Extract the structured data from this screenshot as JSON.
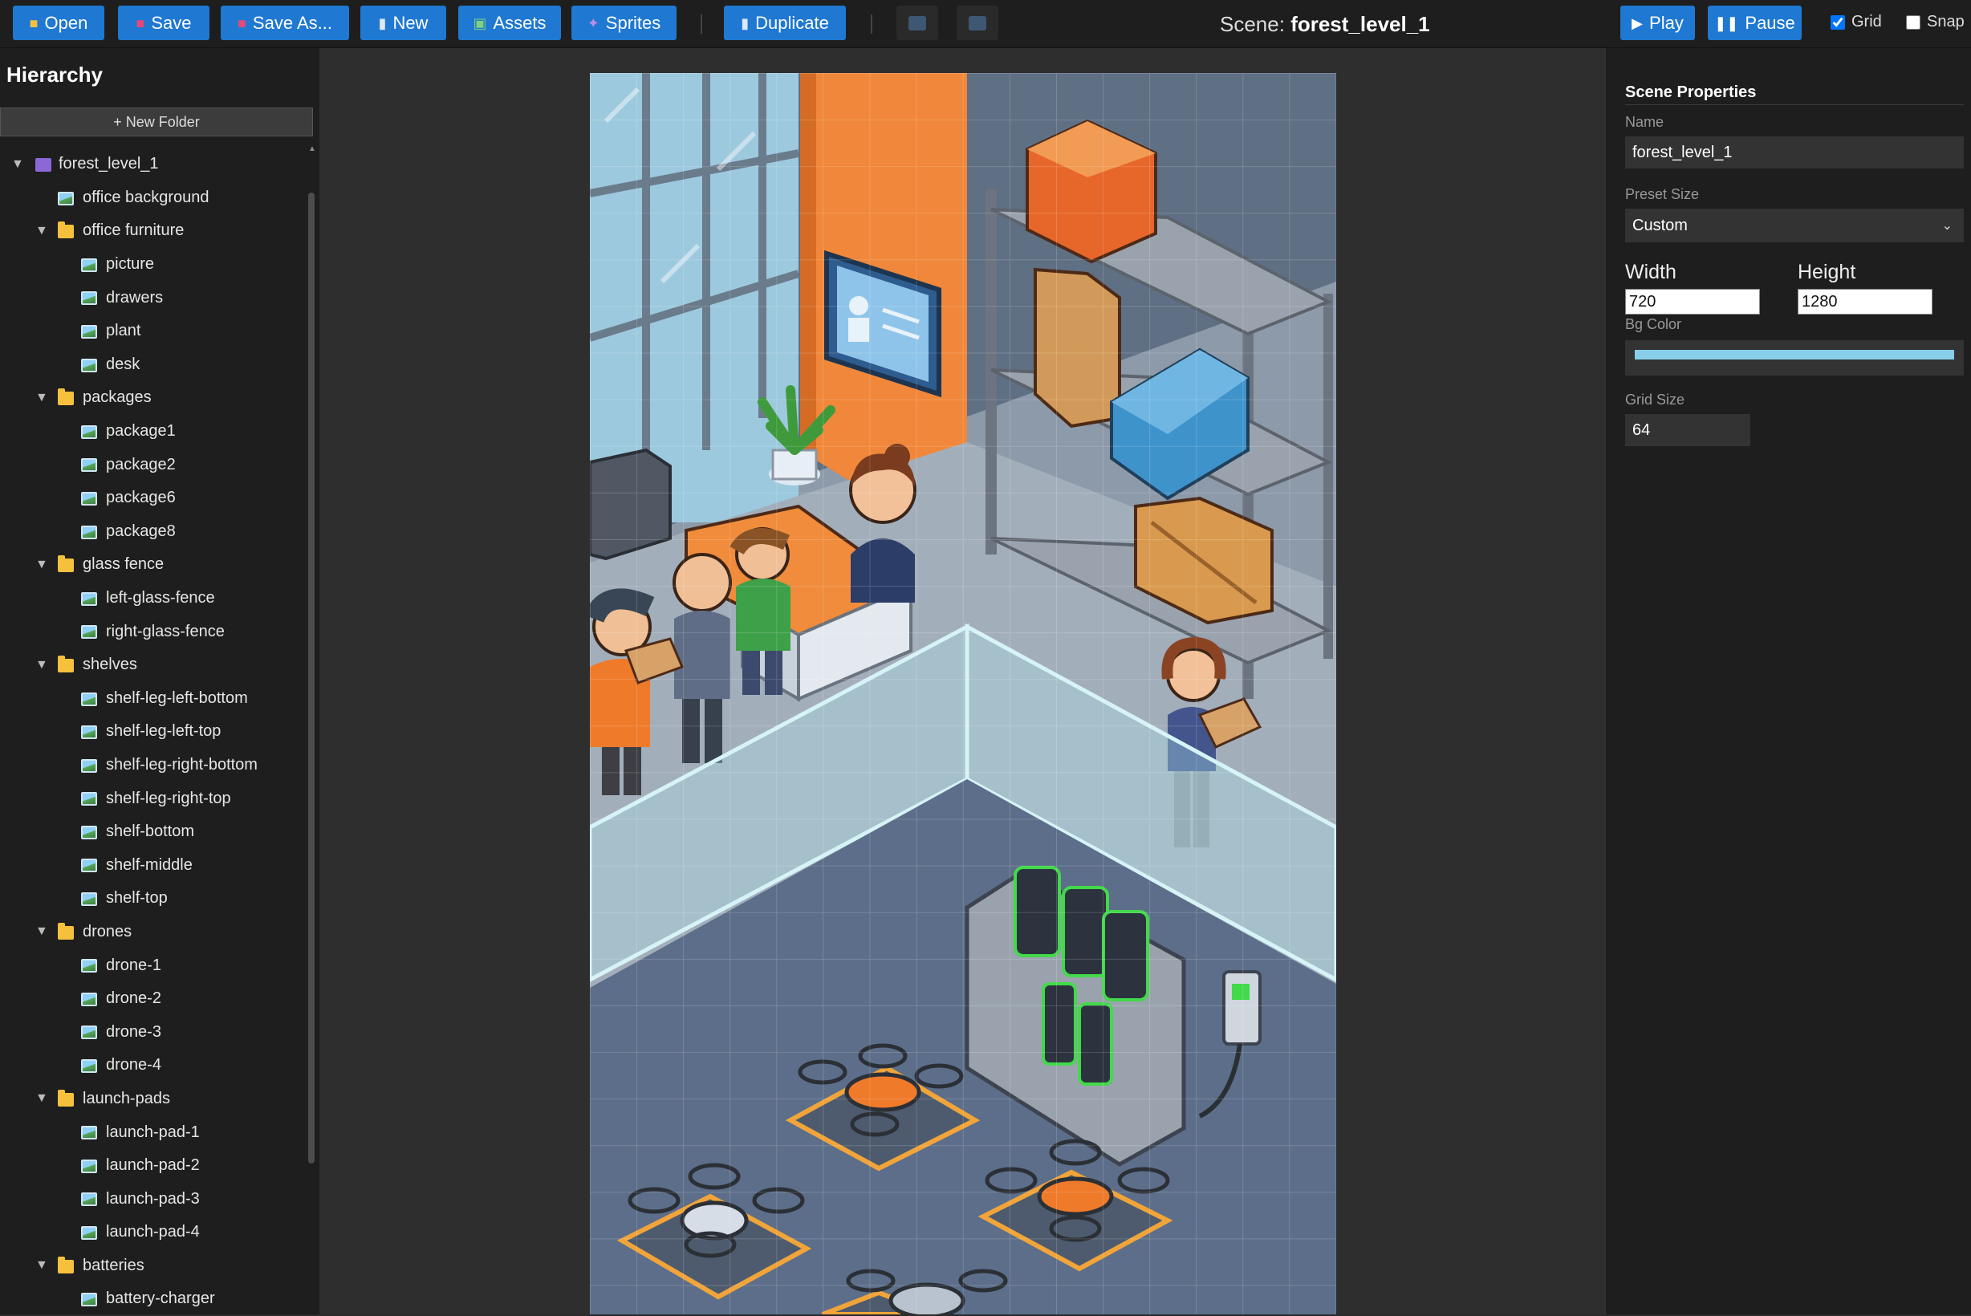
{
  "toolbar": {
    "open": "Open",
    "save": "Save",
    "save_as": "Save As...",
    "new": "New",
    "assets": "Assets",
    "sprites": "Sprites",
    "duplicate": "Duplicate",
    "scene_prefix": "Scene:",
    "scene_name": "forest_level_1",
    "play": "Play",
    "pause": "Pause",
    "grid": "Grid",
    "grid_checked": true,
    "snap": "Snap",
    "snap_checked": false
  },
  "hierarchy": {
    "title": "Hierarchy",
    "new_folder": "+ New Folder",
    "items": [
      {
        "label": "forest_level_1",
        "type": "scene",
        "depth": 0,
        "expanded": true
      },
      {
        "label": "office background",
        "type": "image",
        "depth": 1
      },
      {
        "label": "office furniture",
        "type": "folder",
        "depth": 1,
        "expanded": true
      },
      {
        "label": "picture",
        "type": "image",
        "depth": 2
      },
      {
        "label": "drawers",
        "type": "image",
        "depth": 2
      },
      {
        "label": "plant",
        "type": "image",
        "depth": 2
      },
      {
        "label": "desk",
        "type": "image",
        "depth": 2
      },
      {
        "label": "packages",
        "type": "folder",
        "depth": 1,
        "expanded": true
      },
      {
        "label": "package1",
        "type": "image",
        "depth": 2
      },
      {
        "label": "package2",
        "type": "image",
        "depth": 2
      },
      {
        "label": "package6",
        "type": "image",
        "depth": 2
      },
      {
        "label": "package8",
        "type": "image",
        "depth": 2
      },
      {
        "label": "glass fence",
        "type": "folder",
        "depth": 1,
        "expanded": true
      },
      {
        "label": "left-glass-fence",
        "type": "image",
        "depth": 2
      },
      {
        "label": "right-glass-fence",
        "type": "image",
        "depth": 2
      },
      {
        "label": "shelves",
        "type": "folder",
        "depth": 1,
        "expanded": true
      },
      {
        "label": "shelf-leg-left-bottom",
        "type": "image",
        "depth": 2
      },
      {
        "label": "shelf-leg-left-top",
        "type": "image",
        "depth": 2
      },
      {
        "label": "shelf-leg-right-bottom",
        "type": "image",
        "depth": 2
      },
      {
        "label": "shelf-leg-right-top",
        "type": "image",
        "depth": 2
      },
      {
        "label": "shelf-bottom",
        "type": "image",
        "depth": 2
      },
      {
        "label": "shelf-middle",
        "type": "image",
        "depth": 2
      },
      {
        "label": "shelf-top",
        "type": "image",
        "depth": 2
      },
      {
        "label": "drones",
        "type": "folder",
        "depth": 1,
        "expanded": true
      },
      {
        "label": "drone-1",
        "type": "image",
        "depth": 2
      },
      {
        "label": "drone-2",
        "type": "image",
        "depth": 2
      },
      {
        "label": "drone-3",
        "type": "image",
        "depth": 2
      },
      {
        "label": "drone-4",
        "type": "image",
        "depth": 2
      },
      {
        "label": "launch-pads",
        "type": "folder",
        "depth": 1,
        "expanded": true
      },
      {
        "label": "launch-pad-1",
        "type": "image",
        "depth": 2
      },
      {
        "label": "launch-pad-2",
        "type": "image",
        "depth": 2
      },
      {
        "label": "launch-pad-3",
        "type": "image",
        "depth": 2
      },
      {
        "label": "launch-pad-4",
        "type": "image",
        "depth": 2
      },
      {
        "label": "batteries",
        "type": "folder",
        "depth": 1,
        "expanded": true
      },
      {
        "label": "battery-charger",
        "type": "image",
        "depth": 2
      }
    ]
  },
  "properties": {
    "title": "Scene Properties",
    "name_label": "Name",
    "name_value": "forest_level_1",
    "preset_label": "Preset Size",
    "preset_value": "Custom",
    "width_label": "Width",
    "width_value": "720",
    "height_label": "Height",
    "height_value": "1280",
    "bg_label": "Bg Color",
    "bg_color": "#87ceeb",
    "grid_label": "Grid Size",
    "grid_value": "64"
  },
  "colors": {
    "accent": "#1f78d1",
    "panel": "#1e1e1e",
    "floor": "#9aa6b4",
    "wall": "#6f7f93",
    "orange_pillar": "#f0873a",
    "battery_green": "#42d94a"
  }
}
